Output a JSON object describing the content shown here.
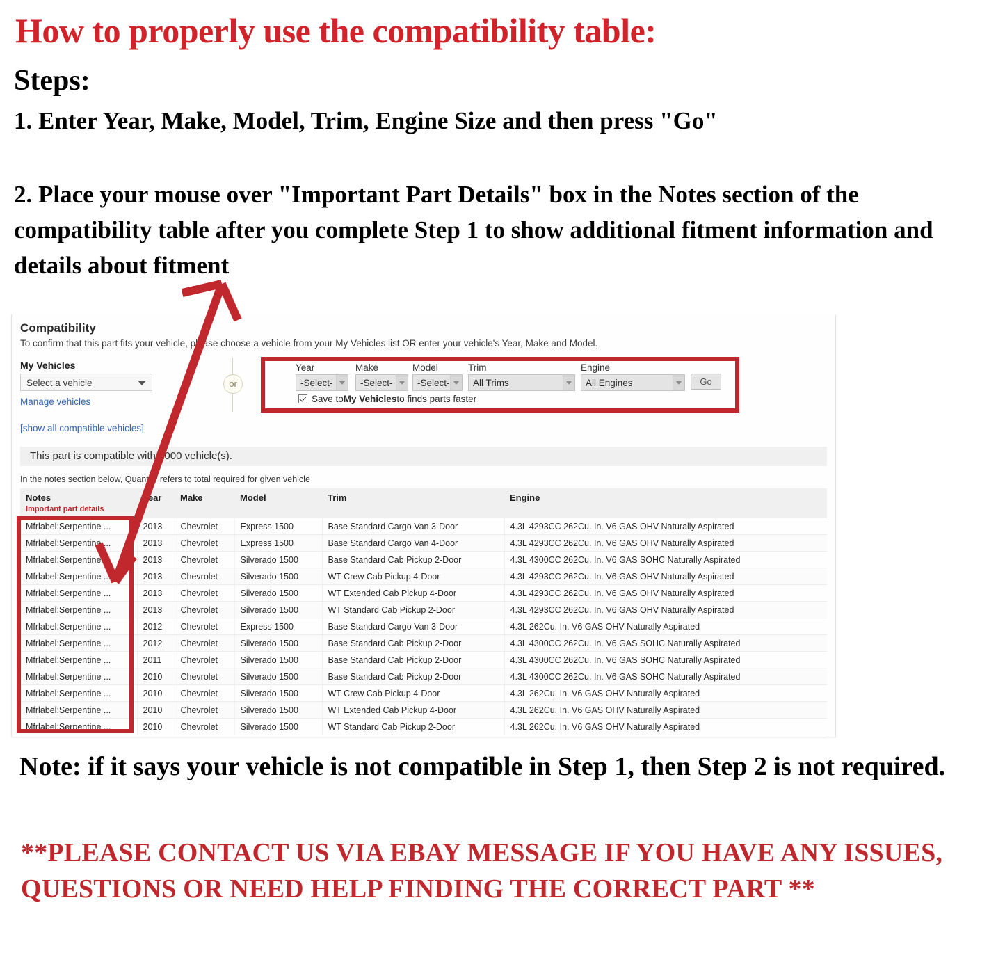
{
  "headline": "How to properly use the compatibility table:",
  "steps_label": "Steps:",
  "step_1": "1. Enter Year, Make, Model, Trim, Engine Size and then press \"Go\"",
  "step_2": "2. Place your mouse over \"Important Part Details\" box in the Notes section of the compatibility table after you complete Step 1 to show additional fitment information and details about fitment",
  "note_line": "Note: if it says your vehicle is not compatible in Step 1, then Step 2 is not required.",
  "contact_line": "**PLEASE CONTACT US VIA EBAY MESSAGE IF YOU HAVE ANY ISSUES, QUESTIONS OR NEED HELP FINDING THE CORRECT PART **",
  "colors": {
    "accent_red": "#c0282d",
    "headline_red": "#d2232a",
    "link_blue": "#3665b3",
    "header_grey": "#f0f0f0"
  },
  "panel": {
    "title": "Compatibility",
    "subtitle": "To confirm that this part fits your vehicle, please choose a vehicle from your My Vehicles list OR enter your vehicle's Year, Make and Model.",
    "my_vehicles": {
      "label": "My Vehicles",
      "select_value": "Select a vehicle",
      "manage_link": "Manage vehicles",
      "show_all_link": "[show all compatible vehicles]"
    },
    "or_label": "or",
    "form": {
      "year": {
        "label": "Year",
        "value": "-Select-"
      },
      "make": {
        "label": "Make",
        "value": "-Select-"
      },
      "model": {
        "label": "Model",
        "value": "-Select-"
      },
      "trim": {
        "label": "Trim",
        "value": "All Trims"
      },
      "engine": {
        "label": "Engine",
        "value": "All Engines"
      },
      "go_label": "Go",
      "save_checkbox_checked": true,
      "save_text_before": "Save to ",
      "save_text_bold": "My Vehicles",
      "save_text_after": " to finds parts faster"
    },
    "compat_bar": "This part is compatible with 1000 vehicle(s).",
    "quantity_note": "In the notes section below, Quantity refers to total required for given vehicle",
    "table": {
      "columns": [
        {
          "label": "Notes",
          "sub": "Important part details"
        },
        {
          "label": "Year",
          "sub": ""
        },
        {
          "label": "Make",
          "sub": ""
        },
        {
          "label": "Model",
          "sub": ""
        },
        {
          "label": "Trim",
          "sub": ""
        },
        {
          "label": "Engine",
          "sub": ""
        }
      ],
      "rows": [
        [
          "Mfrlabel:Serpentine ...",
          "2013",
          "Chevrolet",
          "Express 1500",
          "Base Standard Cargo Van 3-Door",
          "4.3L 4293CC 262Cu. In. V6 GAS OHV Naturally Aspirated"
        ],
        [
          "Mfrlabel:Serpentine ...",
          "2013",
          "Chevrolet",
          "Express 1500",
          "Base Standard Cargo Van 4-Door",
          "4.3L 4293CC 262Cu. In. V6 GAS OHV Naturally Aspirated"
        ],
        [
          "Mfrlabel:Serpentine ...",
          "2013",
          "Chevrolet",
          "Silverado 1500",
          "Base Standard Cab Pickup 2-Door",
          "4.3L 4300CC 262Cu. In. V6 GAS SOHC Naturally Aspirated"
        ],
        [
          "Mfrlabel:Serpentine ...",
          "2013",
          "Chevrolet",
          "Silverado 1500",
          "WT Crew Cab Pickup 4-Door",
          "4.3L 4293CC 262Cu. In. V6 GAS OHV Naturally Aspirated"
        ],
        [
          "Mfrlabel:Serpentine ...",
          "2013",
          "Chevrolet",
          "Silverado 1500",
          "WT Extended Cab Pickup 4-Door",
          "4.3L 4293CC 262Cu. In. V6 GAS OHV Naturally Aspirated"
        ],
        [
          "Mfrlabel:Serpentine ...",
          "2013",
          "Chevrolet",
          "Silverado 1500",
          "WT Standard Cab Pickup 2-Door",
          "4.3L 4293CC 262Cu. In. V6 GAS OHV Naturally Aspirated"
        ],
        [
          "Mfrlabel:Serpentine ...",
          "2012",
          "Chevrolet",
          "Express 1500",
          "Base Standard Cargo Van 3-Door",
          "4.3L 262Cu. In. V6 GAS OHV Naturally Aspirated"
        ],
        [
          "Mfrlabel:Serpentine ...",
          "2012",
          "Chevrolet",
          "Silverado 1500",
          "Base Standard Cab Pickup 2-Door",
          "4.3L 4300CC 262Cu. In. V6 GAS SOHC Naturally Aspirated"
        ],
        [
          "Mfrlabel:Serpentine ...",
          "2011",
          "Chevrolet",
          "Silverado 1500",
          "Base Standard Cab Pickup 2-Door",
          "4.3L 4300CC 262Cu. In. V6 GAS SOHC Naturally Aspirated"
        ],
        [
          "Mfrlabel:Serpentine ...",
          "2010",
          "Chevrolet",
          "Silverado 1500",
          "Base Standard Cab Pickup 2-Door",
          "4.3L 4300CC 262Cu. In. V6 GAS SOHC Naturally Aspirated"
        ],
        [
          "Mfrlabel:Serpentine ...",
          "2010",
          "Chevrolet",
          "Silverado 1500",
          "WT Crew Cab Pickup 4-Door",
          "4.3L 262Cu. In. V6 GAS OHV Naturally Aspirated"
        ],
        [
          "Mfrlabel:Serpentine ...",
          "2010",
          "Chevrolet",
          "Silverado 1500",
          "WT Extended Cab Pickup 4-Door",
          "4.3L 262Cu. In. V6 GAS OHV Naturally Aspirated"
        ],
        [
          "Mfrlabel:Serpentine ...",
          "2010",
          "Chevrolet",
          "Silverado 1500",
          "WT Standard Cab Pickup 2-Door",
          "4.3L 262Cu. In. V6 GAS OHV Naturally Aspirated"
        ]
      ]
    }
  }
}
